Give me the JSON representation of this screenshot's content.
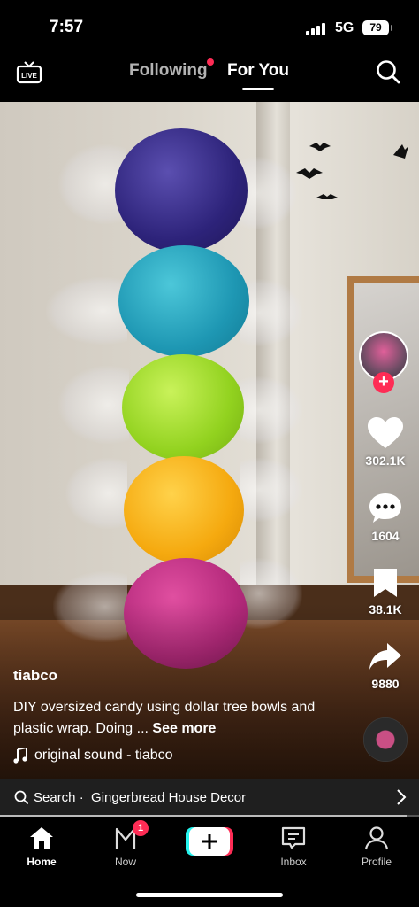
{
  "status_bar": {
    "time": "7:57",
    "network": "5G",
    "battery": "79"
  },
  "top_nav": {
    "live_label": "LIVE",
    "tabs": [
      "Following",
      "For You"
    ],
    "active_tab": "For You"
  },
  "video": {
    "author": "tiabco",
    "description": "DIY oversized candy using dollar tree bowls and plastic wrap. Doing ...",
    "see_more": "See more",
    "sound": "original sound - tiabco"
  },
  "actions": {
    "likes": "302.1K",
    "comments": "1604",
    "saves": "38.1K",
    "shares": "9880"
  },
  "search_bar": {
    "prefix": "Search ·",
    "query": "Gingerbread House Decor"
  },
  "progress": 0.97,
  "bottom_nav": {
    "items": [
      {
        "label": "Home",
        "icon": "home-icon"
      },
      {
        "label": "Now",
        "icon": "now-icon",
        "badge": "1"
      },
      {
        "label": "",
        "icon": "create-icon"
      },
      {
        "label": "Inbox",
        "icon": "inbox-icon"
      },
      {
        "label": "Profile",
        "icon": "profile-icon"
      }
    ]
  },
  "colors": {
    "accent": "#fe2c55",
    "cyan": "#25f4ee",
    "background": "#000000"
  }
}
